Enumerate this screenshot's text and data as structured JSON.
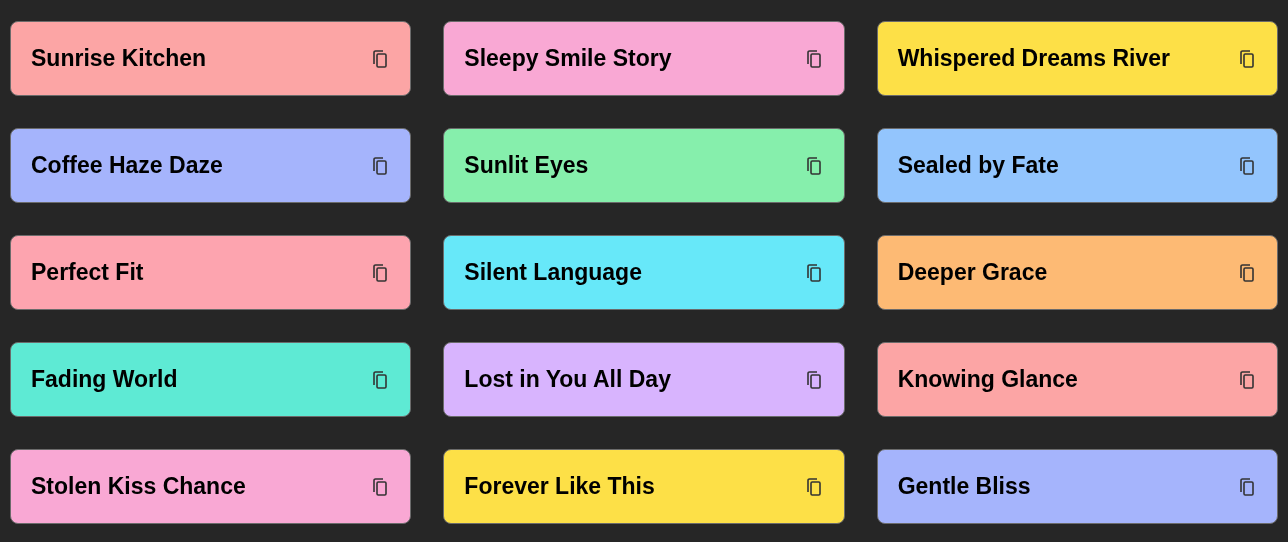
{
  "cards": [
    {
      "title": "Sunrise Kitchen",
      "color": "#fca5a5"
    },
    {
      "title": "Sleepy Smile Story",
      "color": "#f9a8d4"
    },
    {
      "title": "Whispered Dreams River",
      "color": "#fde047"
    },
    {
      "title": "Coffee Haze Daze",
      "color": "#a5b4fc"
    },
    {
      "title": "Sunlit Eyes",
      "color": "#86efac"
    },
    {
      "title": "Sealed by Fate",
      "color": "#93c5fd"
    },
    {
      "title": "Perfect Fit",
      "color": "#fda4af"
    },
    {
      "title": "Silent Language",
      "color": "#67e8f9"
    },
    {
      "title": "Deeper Grace",
      "color": "#fdba74"
    },
    {
      "title": "Fading World",
      "color": "#5eead4"
    },
    {
      "title": "Lost in You All Day",
      "color": "#d8b4fe"
    },
    {
      "title": "Knowing Glance",
      "color": "#fca5a5"
    },
    {
      "title": "Stolen Kiss Chance",
      "color": "#f9a8d4"
    },
    {
      "title": "Forever Like This",
      "color": "#fde047"
    },
    {
      "title": "Gentle Bliss",
      "color": "#a5b4fc"
    }
  ]
}
